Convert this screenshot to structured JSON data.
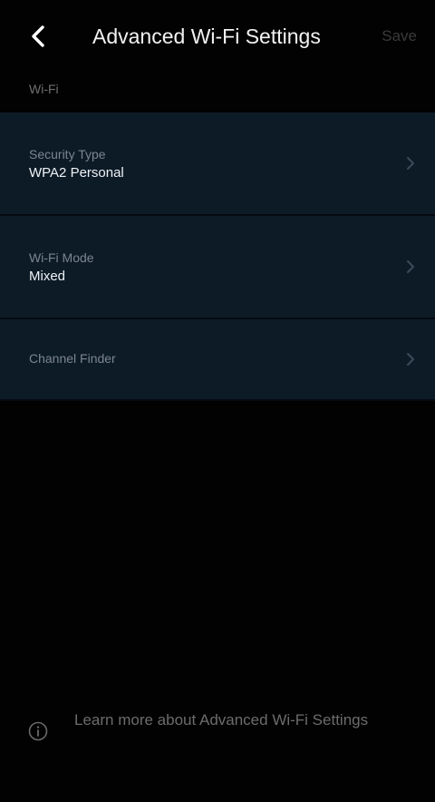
{
  "header": {
    "title": "Advanced Wi-Fi Settings",
    "save_label": "Save",
    "back_icon": "chevron-left-icon"
  },
  "section": {
    "label": "Wi-Fi"
  },
  "settings": [
    {
      "label": "Security Type",
      "value": "WPA2 Personal"
    },
    {
      "label": "Wi-Fi Mode",
      "value": "Mixed"
    },
    {
      "label": "Channel Finder"
    }
  ],
  "footer": {
    "learn_more": "Learn more about Advanced Wi-Fi Settings",
    "icon": "info-icon"
  },
  "colors": {
    "background": "#020202",
    "row_background": "#0d1b27",
    "title": "#f2f2f2",
    "muted_text": "#6c6c6c",
    "disabled_save": "#3a3a3a"
  }
}
